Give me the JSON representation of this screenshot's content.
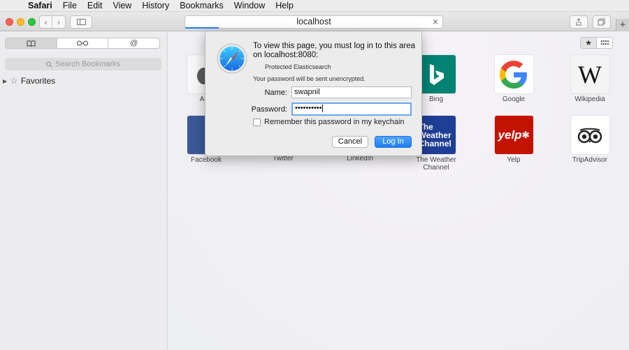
{
  "menubar": {
    "app": "Safari",
    "items": [
      "File",
      "Edit",
      "View",
      "History",
      "Bookmarks",
      "Window",
      "Help"
    ]
  },
  "toolbar": {
    "address": "localhost"
  },
  "sidebar": {
    "search_placeholder": "Search Bookmarks",
    "favorites_label": "Favorites"
  },
  "favorites": [
    {
      "label": "Apple",
      "visible_label": "Ap"
    },
    {
      "label": "Bing"
    },
    {
      "label": "Google"
    },
    {
      "label": "Wikipedia"
    },
    {
      "label": "Facebook"
    },
    {
      "label": "Twitter"
    },
    {
      "label": "LinkedIn"
    },
    {
      "label": "The Weather Channel",
      "tile_text": "The Weather Channel"
    },
    {
      "label": "Yelp",
      "tile_text": "yelp"
    },
    {
      "label": "TripAdvisor"
    }
  ],
  "dialog": {
    "message": "To view this page, you must log in to this area on localhost:8080:",
    "realm": "Protected Elasticsearch",
    "warning": "Your password will be sent unencrypted.",
    "name_label": "Name:",
    "name_value": "swapnil",
    "password_label": "Password:",
    "password_value": "••••••••••",
    "remember_label": "Remember this password in my keychain",
    "cancel_label": "Cancel",
    "login_label": "Log In"
  },
  "colors": {
    "accent": "#1d7df4",
    "bing": "#008373",
    "weather": "#1f3e96",
    "yelp": "#c41200",
    "facebook": "#3b5998"
  }
}
